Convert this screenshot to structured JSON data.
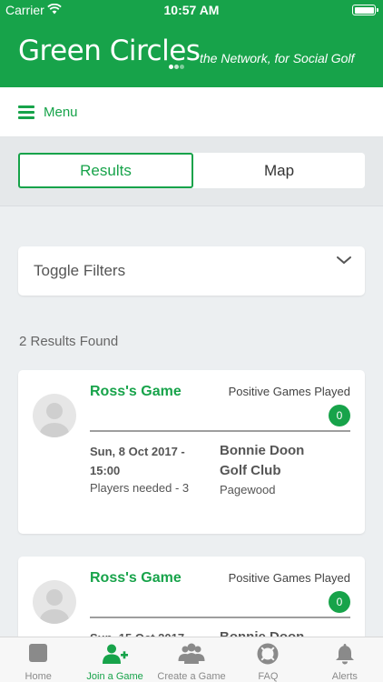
{
  "status_bar": {
    "carrier": "Carrier",
    "time": "10:57 AM"
  },
  "header": {
    "title": "Green Circles",
    "tagline": "the Network, for Social Golf"
  },
  "menu": {
    "label": "Menu"
  },
  "tabs": [
    {
      "label": "Results",
      "active": true
    },
    {
      "label": "Map",
      "active": false
    }
  ],
  "filters": {
    "label": "Toggle Filters"
  },
  "results": {
    "count_text": "2 Results Found",
    "games": [
      {
        "title": "Ross's Game",
        "positive_label": "Positive Games Played",
        "positive_count": "0",
        "date": "Sun, 8 Oct 2017 - 15:00",
        "players_needed": "Players needed - 3",
        "club": "Bonnie Doon Golf Club",
        "suburb": "Pagewood"
      },
      {
        "title": "Ross's Game",
        "positive_label": "Positive Games Played",
        "positive_count": "0",
        "date": "Sun, 15 Oct 2017 -",
        "club": "Bonnie Doon"
      }
    ]
  },
  "tab_bar": [
    {
      "label": "Home",
      "icon": "home-icon"
    },
    {
      "label": "Join a Game",
      "icon": "join-game-icon",
      "active": true
    },
    {
      "label": "Create a Game",
      "icon": "create-game-icon"
    },
    {
      "label": "FAQ",
      "icon": "faq-lifebuoy-icon"
    },
    {
      "label": "Alerts",
      "icon": "bell-icon"
    }
  ],
  "colors": {
    "brand": "#17a34a",
    "inactive": "#8a8a8a"
  }
}
